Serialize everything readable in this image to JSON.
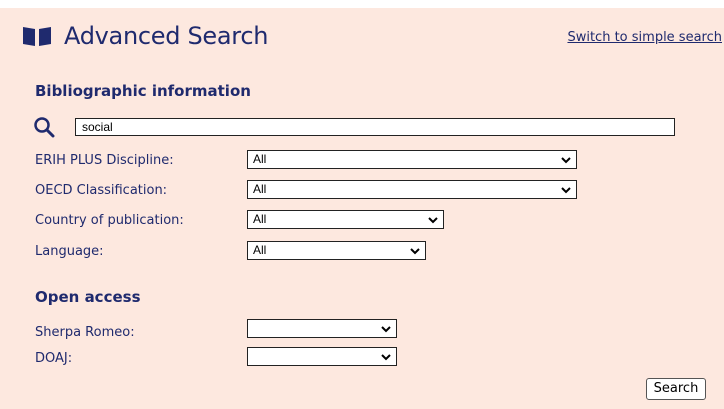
{
  "header": {
    "title": "Advanced Search",
    "switch_link": "Switch to simple search",
    "icon": "book-open-icon"
  },
  "bibliographic": {
    "heading": "Bibliographic information",
    "search_value": "social",
    "search_icon": "search-icon",
    "fields": [
      {
        "label": "ERIH PLUS Discipline:",
        "value": "All"
      },
      {
        "label": "OECD Classification:",
        "value": "All"
      },
      {
        "label": "Country of publication:",
        "value": "All"
      },
      {
        "label": "Language:",
        "value": "All"
      }
    ]
  },
  "open_access": {
    "heading": "Open access",
    "fields": [
      {
        "label": "Sherpa Romeo:",
        "value": ""
      },
      {
        "label": "DOAJ:",
        "value": ""
      }
    ]
  },
  "actions": {
    "search_label": "Search"
  },
  "colors": {
    "panel_bg": "#fde8df",
    "brand": "#1f2a6e"
  }
}
